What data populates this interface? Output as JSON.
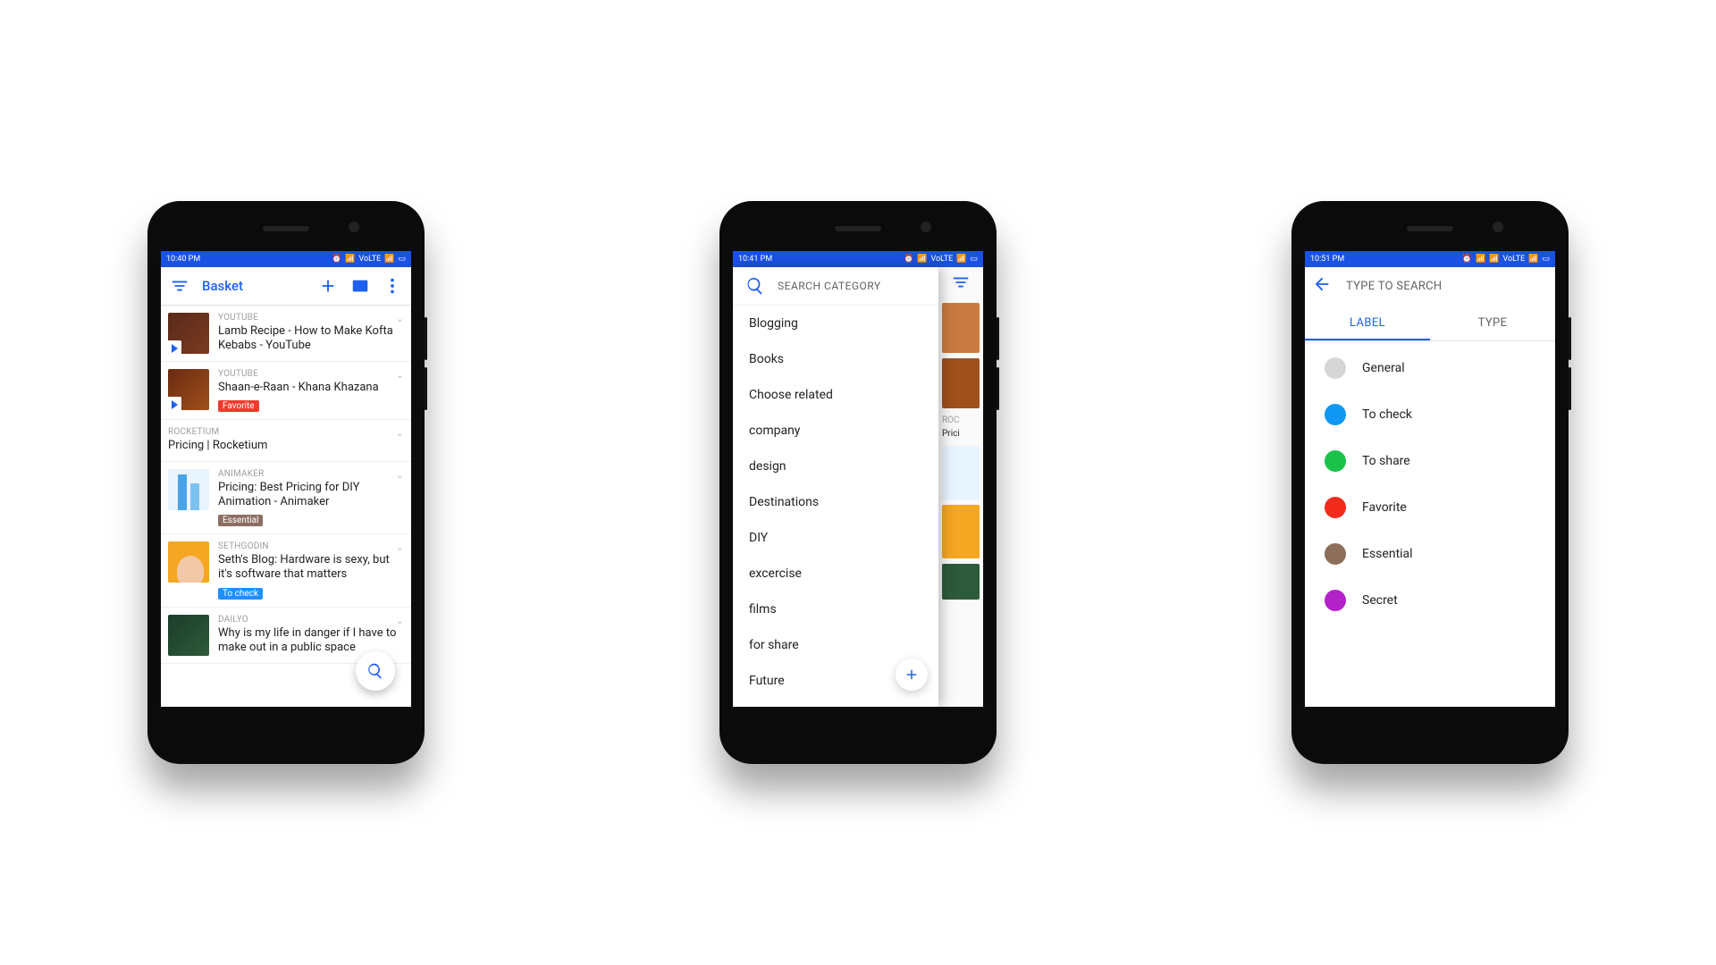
{
  "status": {
    "time1": "10:40 PM",
    "time2": "10:41 PM",
    "time3": "10:51 PM",
    "net": "VoLTE"
  },
  "s1": {
    "title": "Basket",
    "items": [
      {
        "src": "YOUTUBE",
        "title": "Lamb Recipe - How to Make Kofta Kebabs - YouTube",
        "thumb": "t-yt1",
        "play": true
      },
      {
        "src": "YOUTUBE",
        "title": "Shaan-e-Raan - Khana Khazana",
        "thumb": "t-yt2",
        "play": true,
        "badge": {
          "text": "Favorite",
          "color": "#F03B2D"
        }
      },
      {
        "src": "ROCKETIUM",
        "title": "Pricing | Rocketium",
        "thumb": null
      },
      {
        "src": "ANIMAKER",
        "title": "Pricing: Best Pricing for DIY Animation - Animaker",
        "thumb": "t-anim",
        "badge": {
          "text": "Essential",
          "color": "#8D6E63"
        }
      },
      {
        "src": "SETHGODIN",
        "title": "Seth's Blog: Hardware is sexy, but it's software that matters",
        "thumb": "t-seth",
        "badge": {
          "text": "To check",
          "color": "#1E90FF"
        }
      },
      {
        "src": "DAILYO",
        "title": "Why is my life in danger if I have to make out in a public space",
        "thumb": "t-dailyo"
      }
    ]
  },
  "s2": {
    "search_label": "SEARCH CATEGORY",
    "categories": [
      "Blogging",
      "Books",
      "Choose related",
      "company",
      "design",
      "Destinations",
      "DIY",
      "excercise",
      "films",
      "for share",
      "Future"
    ],
    "peek": {
      "src": "ROC",
      "title": "Prici"
    }
  },
  "s3": {
    "hint": "TYPE TO SEARCH",
    "tabs": [
      "LABEL",
      "TYPE"
    ],
    "active_tab": 0,
    "labels": [
      {
        "name": "General",
        "color": "#D6D6D6"
      },
      {
        "name": "To check",
        "color": "#0E98F4"
      },
      {
        "name": "To share",
        "color": "#1BC24A"
      },
      {
        "name": "Favorite",
        "color": "#F12A1C"
      },
      {
        "name": "Essential",
        "color": "#8D6E5A"
      },
      {
        "name": "Secret",
        "color": "#B321C9"
      }
    ]
  }
}
